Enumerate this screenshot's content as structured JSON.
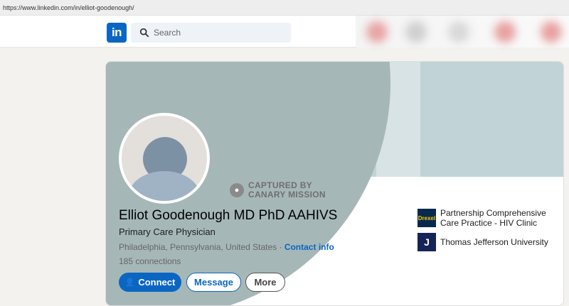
{
  "browser": {
    "url": "https://www.linkedin.com/in/elliot-goodenough/"
  },
  "nav": {
    "logo_text": "in",
    "search_placeholder": "Search"
  },
  "profile": {
    "stamp_line1": "CAPTURED BY",
    "stamp_line2": "CANARY MISSION",
    "name": "Elliot Goodenough MD PhD AAHIVS",
    "headline": "Primary Care Physician",
    "location": "Philadelphia, Pennsylvania, United States",
    "separator": " · ",
    "contact_info": "Contact info",
    "connections": "185 connections",
    "buttons": {
      "connect": "Connect",
      "message": "Message",
      "more": "More"
    },
    "organizations": [
      {
        "name": "Partnership Comprehensive Care Practice - HIV Clinic",
        "logo_text": "Drexel"
      },
      {
        "name": "Thomas Jefferson University",
        "logo_text": "J"
      }
    ]
  },
  "colors": {
    "brand": "#0a66c2",
    "banner_dark": "#a6b7b8",
    "banner_light": "#c2d3d7"
  }
}
